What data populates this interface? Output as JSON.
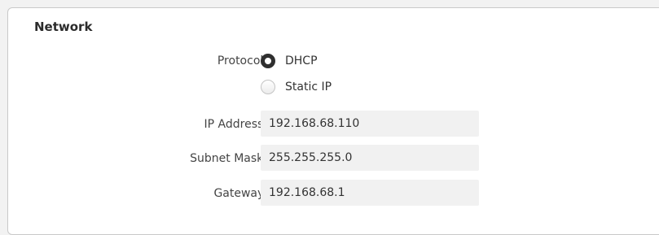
{
  "section": {
    "title": "Network"
  },
  "protocol": {
    "label": "Protocol:",
    "options": [
      {
        "label": "DHCP",
        "selected": true
      },
      {
        "label": "Static IP",
        "selected": false
      }
    ]
  },
  "ip_address": {
    "label": "IP Address:",
    "value": "192.168.68.110"
  },
  "subnet_mask": {
    "label": "Subnet Mask:",
    "value": "255.255.255.0"
  },
  "gateway": {
    "label": "Gateway:",
    "value": "192.168.68.1"
  }
}
